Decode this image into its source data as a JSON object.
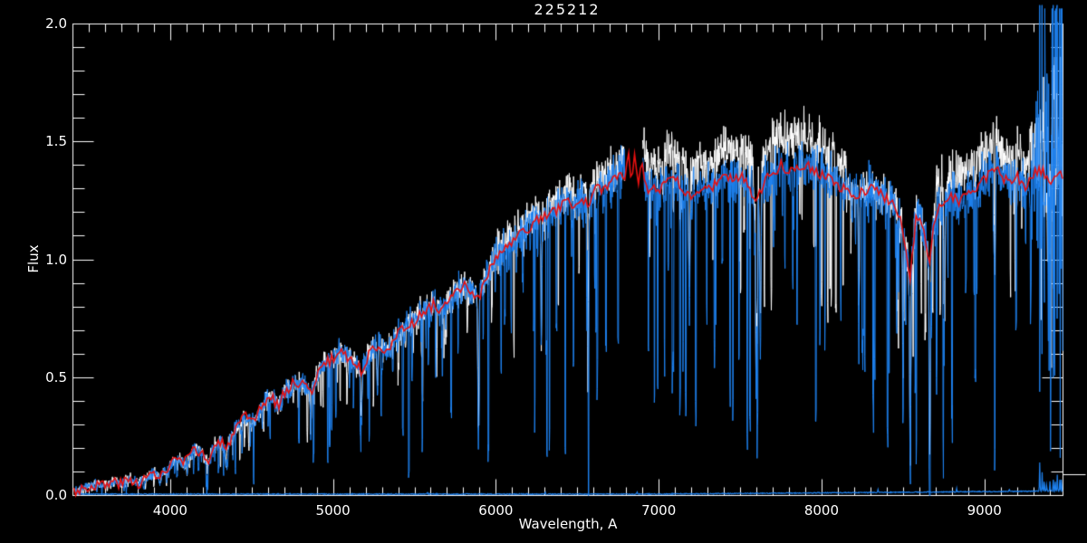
{
  "chart_data": {
    "type": "line",
    "title": "225212",
    "xlabel": "Wavelength, A",
    "ylabel": "Flux",
    "xlim": [
      3400,
      9480
    ],
    "ylim": [
      0.0,
      2.0
    ],
    "x_minor_step": 100,
    "y_minor_step": 0.1,
    "background": "#000000",
    "frame_color": "#ffffff",
    "grid": false,
    "legend": null,
    "x_ticks": [
      {
        "value": 4000,
        "label": "4000"
      },
      {
        "value": 5000,
        "label": "5000"
      },
      {
        "value": 6000,
        "label": "6000"
      },
      {
        "value": 7000,
        "label": "7000"
      },
      {
        "value": 8000,
        "label": "8000"
      },
      {
        "value": 9000,
        "label": "9000"
      }
    ],
    "y_ticks": [
      {
        "value": 0.0,
        "label": "0.0"
      },
      {
        "value": 0.5,
        "label": "0.5"
      },
      {
        "value": 1.0,
        "label": "1.0"
      },
      {
        "value": 1.5,
        "label": "1.5"
      },
      {
        "value": 2.0,
        "label": "2.0"
      }
    ],
    "gap": [
      6788,
      6898
    ],
    "continuum": [
      [
        3400,
        0.02
      ],
      [
        3450,
        0.03
      ],
      [
        3500,
        0.035
      ],
      [
        3550,
        0.05
      ],
      [
        3600,
        0.04
      ],
      [
        3650,
        0.06
      ],
      [
        3700,
        0.05
      ],
      [
        3750,
        0.065
      ],
      [
        3800,
        0.055
      ],
      [
        3850,
        0.07
      ],
      [
        3900,
        0.1
      ],
      [
        3935,
        0.07
      ],
      [
        3960,
        0.11
      ],
      [
        3975,
        0.09
      ],
      [
        4000,
        0.13
      ],
      [
        4040,
        0.16
      ],
      [
        4080,
        0.13
      ],
      [
        4120,
        0.17
      ],
      [
        4160,
        0.2
      ],
      [
        4200,
        0.17
      ],
      [
        4230,
        0.14
      ],
      [
        4270,
        0.21
      ],
      [
        4310,
        0.23
      ],
      [
        4340,
        0.18
      ],
      [
        4380,
        0.27
      ],
      [
        4420,
        0.3
      ],
      [
        4460,
        0.33
      ],
      [
        4500,
        0.3
      ],
      [
        4540,
        0.35
      ],
      [
        4580,
        0.4
      ],
      [
        4620,
        0.42
      ],
      [
        4660,
        0.38
      ],
      [
        4700,
        0.44
      ],
      [
        4750,
        0.47
      ],
      [
        4800,
        0.49
      ],
      [
        4860,
        0.43
      ],
      [
        4900,
        0.52
      ],
      [
        4950,
        0.56
      ],
      [
        5000,
        0.58
      ],
      [
        5050,
        0.62
      ],
      [
        5100,
        0.58
      ],
      [
        5170,
        0.53
      ],
      [
        5220,
        0.6
      ],
      [
        5270,
        0.64
      ],
      [
        5320,
        0.62
      ],
      [
        5370,
        0.66
      ],
      [
        5420,
        0.7
      ],
      [
        5470,
        0.73
      ],
      [
        5520,
        0.75
      ],
      [
        5570,
        0.79
      ],
      [
        5620,
        0.81
      ],
      [
        5670,
        0.79
      ],
      [
        5720,
        0.83
      ],
      [
        5770,
        0.87
      ],
      [
        5820,
        0.89
      ],
      [
        5890,
        0.83
      ],
      [
        5940,
        0.93
      ],
      [
        5990,
        0.99
      ],
      [
        6040,
        1.04
      ],
      [
        6090,
        1.07
      ],
      [
        6140,
        1.1
      ],
      [
        6190,
        1.13
      ],
      [
        6240,
        1.16
      ],
      [
        6290,
        1.18
      ],
      [
        6340,
        1.2
      ],
      [
        6390,
        1.22
      ],
      [
        6440,
        1.25
      ],
      [
        6490,
        1.23
      ],
      [
        6540,
        1.26
      ],
      [
        6563,
        1.21
      ],
      [
        6610,
        1.29
      ],
      [
        6660,
        1.31
      ],
      [
        6710,
        1.33
      ],
      [
        6760,
        1.37
      ],
      [
        6790,
        1.36
      ],
      [
        6810,
        1.46
      ],
      [
        6830,
        1.33
      ],
      [
        6850,
        1.45
      ],
      [
        6870,
        1.32
      ],
      [
        6890,
        1.44
      ],
      [
        6910,
        1.36
      ],
      [
        6930,
        1.3
      ],
      [
        6960,
        1.31
      ],
      [
        7000,
        1.28
      ],
      [
        7050,
        1.33
      ],
      [
        7100,
        1.34
      ],
      [
        7150,
        1.29
      ],
      [
        7200,
        1.26
      ],
      [
        7250,
        1.31
      ],
      [
        7300,
        1.29
      ],
      [
        7350,
        1.33
      ],
      [
        7400,
        1.36
      ],
      [
        7450,
        1.34
      ],
      [
        7500,
        1.36
      ],
      [
        7550,
        1.31
      ],
      [
        7600,
        1.26
      ],
      [
        7650,
        1.34
      ],
      [
        7700,
        1.38
      ],
      [
        7750,
        1.4
      ],
      [
        7800,
        1.38
      ],
      [
        7850,
        1.4
      ],
      [
        7900,
        1.41
      ],
      [
        7950,
        1.38
      ],
      [
        8000,
        1.36
      ],
      [
        8050,
        1.34
      ],
      [
        8100,
        1.31
      ],
      [
        8150,
        1.29
      ],
      [
        8200,
        1.26
      ],
      [
        8250,
        1.29
      ],
      [
        8300,
        1.31
      ],
      [
        8350,
        1.29
      ],
      [
        8400,
        1.26
      ],
      [
        8450,
        1.22
      ],
      [
        8500,
        1.12
      ],
      [
        8540,
        0.93
      ],
      [
        8580,
        1.2
      ],
      [
        8620,
        1.14
      ],
      [
        8660,
        0.98
      ],
      [
        8700,
        1.21
      ],
      [
        8750,
        1.24
      ],
      [
        8800,
        1.27
      ],
      [
        8850,
        1.24
      ],
      [
        8900,
        1.29
      ],
      [
        8950,
        1.31
      ],
      [
        9000,
        1.34
      ],
      [
        9050,
        1.4
      ],
      [
        9100,
        1.36
      ],
      [
        9150,
        1.32
      ],
      [
        9200,
        1.35
      ],
      [
        9250,
        1.31
      ],
      [
        9300,
        1.36
      ],
      [
        9350,
        1.38
      ],
      [
        9400,
        1.34
      ],
      [
        9450,
        1.38
      ],
      [
        9480,
        1.35
      ]
    ],
    "absorption_lines": [
      [
        3933,
        0.5,
        4
      ],
      [
        4101,
        0.35,
        4
      ],
      [
        4226,
        0.4,
        3
      ],
      [
        4340,
        0.4,
        4
      ],
      [
        4383,
        0.35,
        3
      ],
      [
        4861,
        0.45,
        4
      ],
      [
        5172,
        0.45,
        5
      ],
      [
        5270,
        0.35,
        4
      ],
      [
        5890,
        0.8,
        5
      ],
      [
        6277,
        0.5,
        4
      ],
      [
        6563,
        0.5,
        4
      ],
      [
        7186,
        0.45,
        5
      ],
      [
        7594,
        0.7,
        8
      ],
      [
        7621,
        0.55,
        6
      ],
      [
        8227,
        0.5,
        4
      ],
      [
        8498,
        0.65,
        4
      ],
      [
        8542,
        0.96,
        5
      ],
      [
        8662,
        0.96,
        5
      ],
      [
        8750,
        0.5,
        4
      ],
      [
        9061,
        0.5,
        4
      ]
    ],
    "emission_spike": {
      "wavelength": 7590,
      "width": 3
    },
    "noise_blowup": {
      "range": [
        9265,
        9480
      ]
    },
    "right_axis_outward_tick": {
      "flux": 0.09
    },
    "series": [
      {
        "name": "raw-spectrum",
        "color": "#ffffff",
        "seed": 77,
        "start": 3412,
        "step": 2.2,
        "amp_base": 0.02,
        "amp_scale": 0.055,
        "spike_prob": 0.05,
        "spike_depth": 0.5,
        "line_scale": 0.85,
        "respect_gap": true,
        "blowup": 5,
        "cap": 1.86,
        "emission_peak": 1.84,
        "boost": [
          [
            5990,
            6788,
            1.03
          ],
          [
            6898,
            8150,
            1.085
          ],
          [
            8700,
            9470,
            1.08
          ]
        ],
        "extra_lines": [
          [
            8470,
            0.5,
            2
          ],
          [
            8510,
            0.45,
            2
          ],
          [
            8560,
            0.5,
            2
          ],
          [
            8610,
            0.45,
            2
          ],
          [
            8680,
            0.4,
            2
          ]
        ],
        "verticals": []
      },
      {
        "name": "calibrated-spectrum",
        "color": "#1e82f0",
        "seed": 13,
        "start": 3415,
        "step": 2.2,
        "amp_base": 0.018,
        "amp_scale": 0.06,
        "spike_prob": 0.085,
        "spike_depth": 0.85,
        "line_scale": 1.0,
        "respect_gap": true,
        "blowup": 13,
        "cap": 2.1,
        "emission_peak": 1.79,
        "boost": [],
        "extra_lines": [],
        "verticals": [
          [
            9337,
            2.08,
            0.44
          ],
          [
            9351,
            2.08,
            0.6
          ],
          [
            9420,
            2.08,
            0.5
          ],
          [
            9444,
            2.08,
            0.75
          ]
        ]
      },
      {
        "name": "sky-background",
        "color": "#1e82f0",
        "seed": 5,
        "type": "sky",
        "start": 3430,
        "step": 3,
        "base": 0.004,
        "jitter": 0.004,
        "slope_from": 7000,
        "slope_amount": 0.013,
        "spikes": [
          [
            5577,
            0.01
          ],
          [
            6300,
            0.009
          ],
          [
            6864,
            0.012
          ],
          [
            8344,
            0.014
          ],
          [
            8827,
            0.015
          ],
          [
            9150,
            0.012
          ],
          [
            9337,
            0.125
          ],
          [
            9352,
            0.08
          ],
          [
            9365,
            0.05
          ],
          [
            9380,
            0.03
          ],
          [
            9400,
            0.04
          ],
          [
            9420,
            0.06
          ],
          [
            9432,
            0.05
          ],
          [
            9445,
            0.07
          ],
          [
            9460,
            0.05
          ],
          [
            9470,
            0.06
          ]
        ]
      },
      {
        "name": "template-fit",
        "color": "#e81010",
        "seed": 3,
        "type": "smooth",
        "start": 3405,
        "step": 12,
        "jitter": 0.05
      }
    ]
  }
}
